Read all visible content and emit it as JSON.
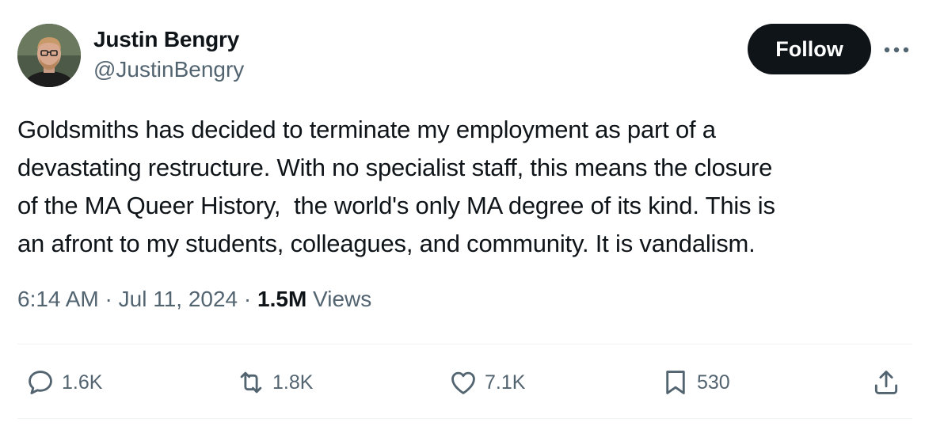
{
  "author": {
    "display_name": "Justin Bengry",
    "handle": "@JustinBengry",
    "avatar_icon": "profile-photo"
  },
  "follow_label": "Follow",
  "tweet": {
    "lines": [
      "Goldsmiths has decided to terminate my employment as part of a",
      "devastating restructure. With no specialist staff, this means the closure",
      "of the MA Queer History,  the world's only MA degree of its kind. This is",
      "an afront to my students, colleagues, and community. It is vandalism."
    ]
  },
  "meta": {
    "time": "6:14 AM",
    "separator": "·",
    "date": "Jul 11, 2024",
    "views_count": "1.5M",
    "views_label": "Views"
  },
  "actions": {
    "replies": {
      "icon": "reply-icon",
      "count": "1.6K"
    },
    "reposts": {
      "icon": "repost-icon",
      "count": "1.8K"
    },
    "likes": {
      "icon": "heart-icon",
      "count": "7.1K"
    },
    "bookmarks": {
      "icon": "bookmark-icon",
      "count": "530"
    },
    "share": {
      "icon": "share-icon"
    }
  },
  "colors": {
    "text_primary": "#0f1419",
    "text_secondary": "#536471",
    "button_bg": "#0f1419",
    "divider": "#eff3f4"
  }
}
